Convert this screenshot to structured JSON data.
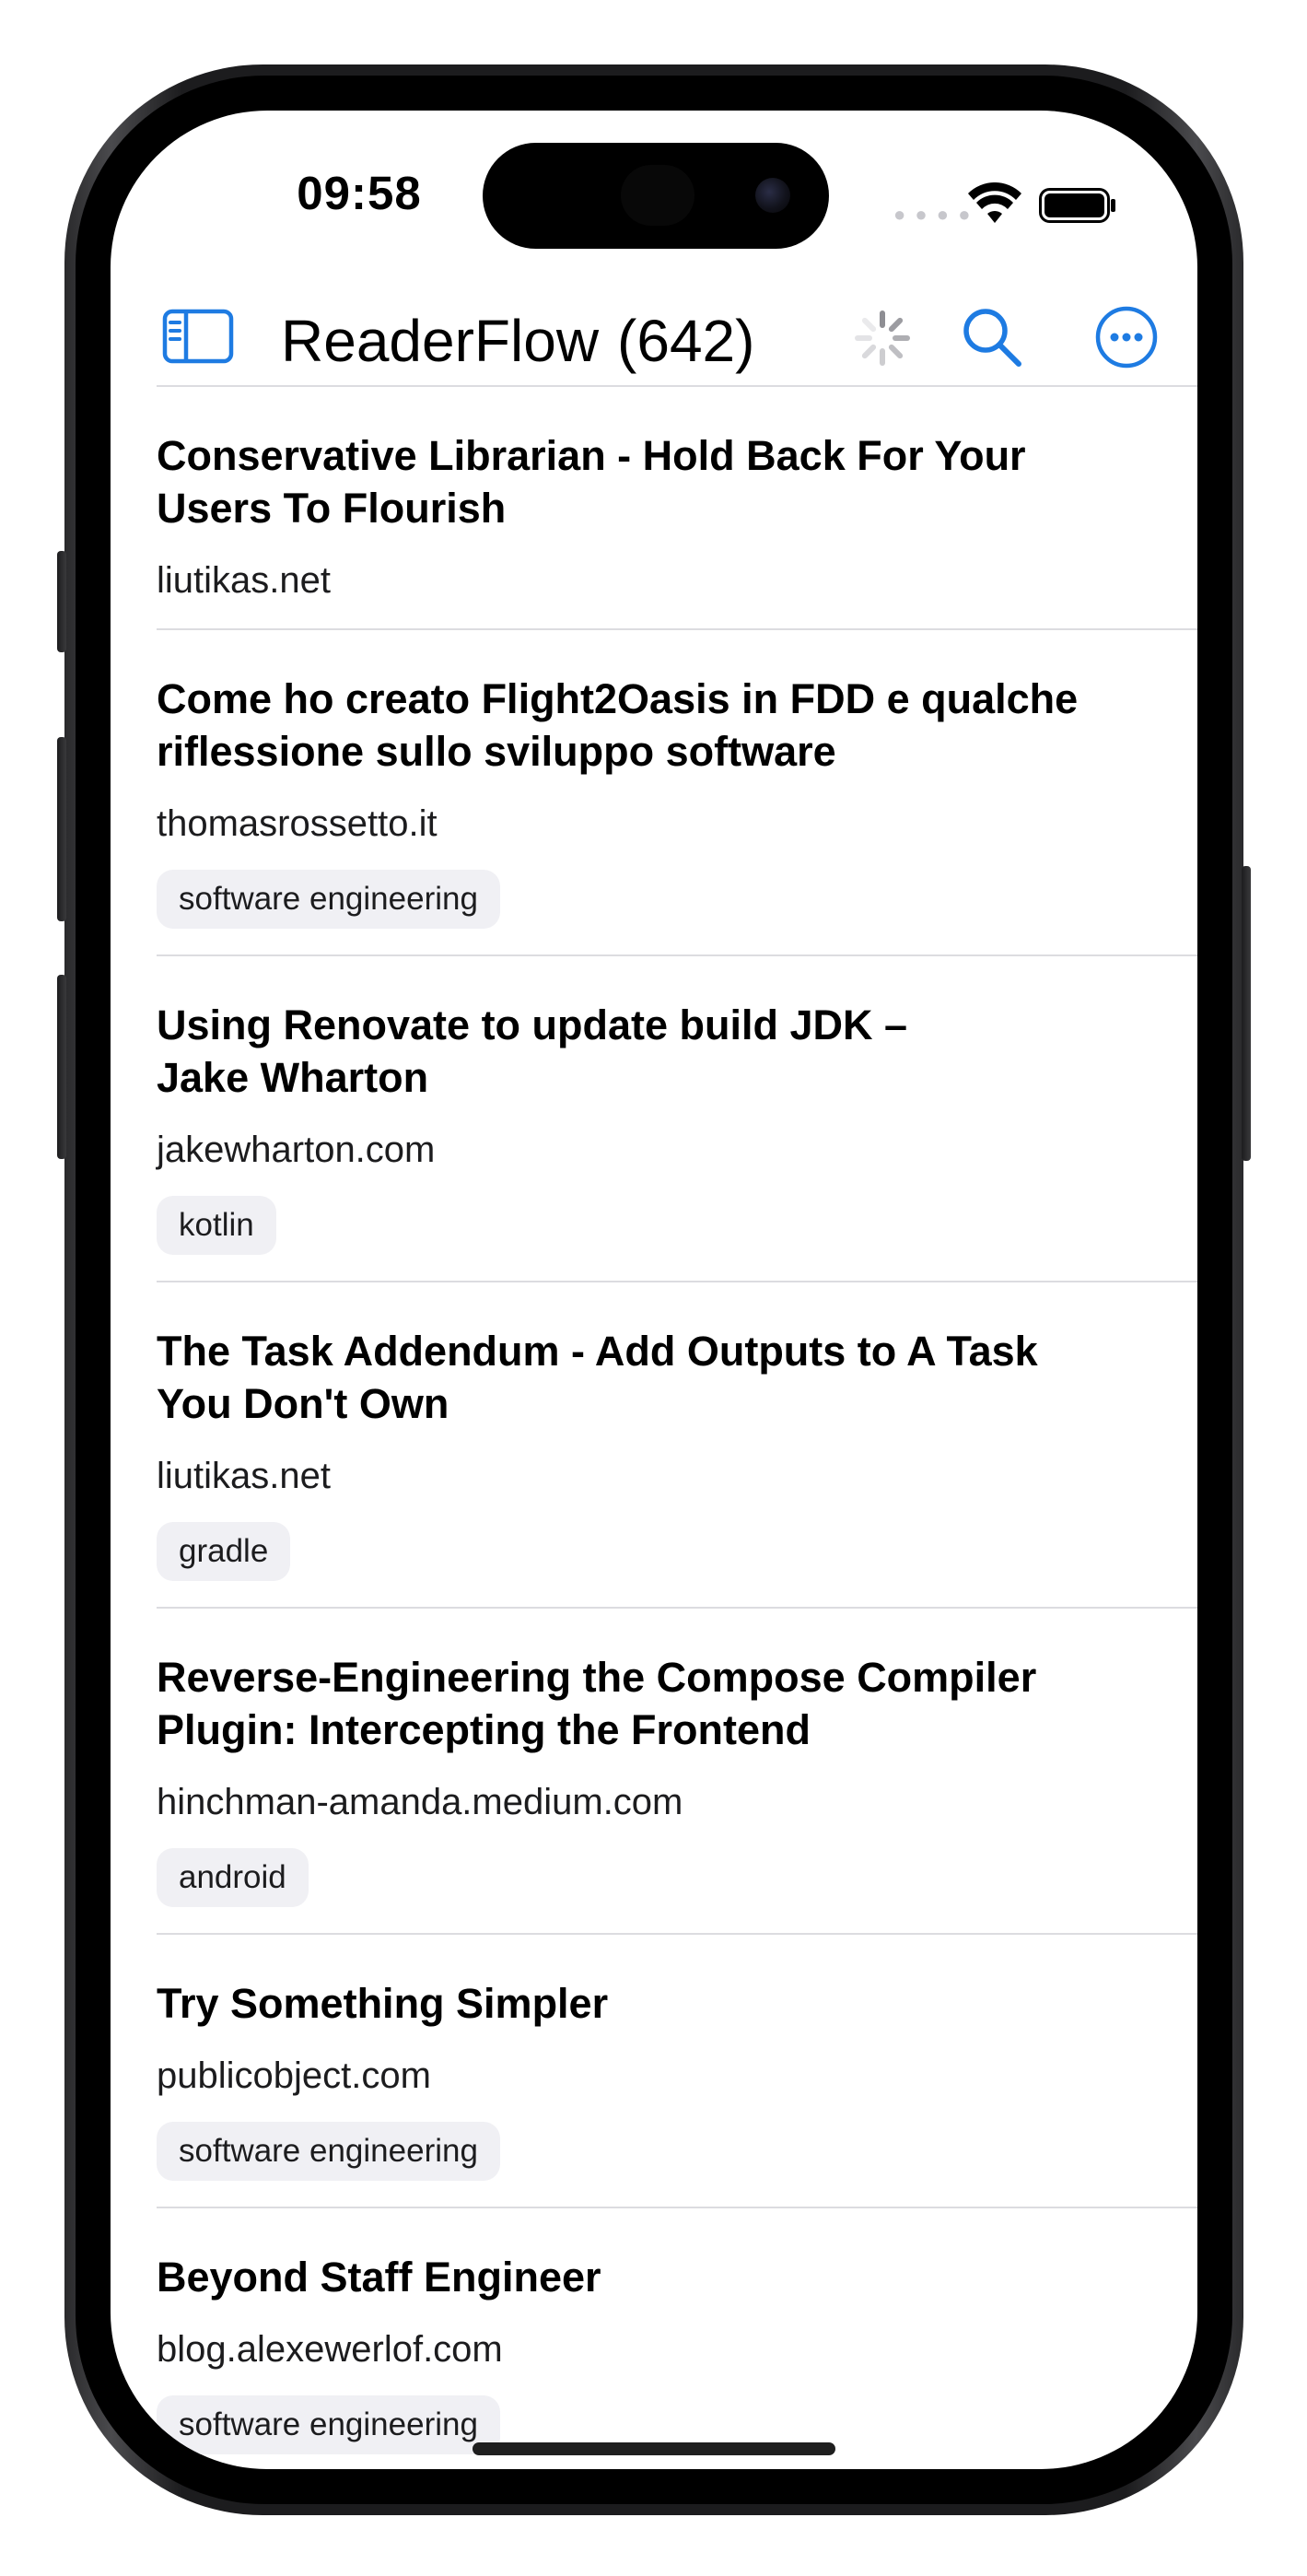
{
  "status_bar": {
    "time": "09:58"
  },
  "nav": {
    "app_name": "ReaderFlow",
    "count": "(642)",
    "accent_color": "#1E7BE2"
  },
  "articles": [
    {
      "title": "Conservative Librarian - Hold Back For Your\nUsers To Flourish",
      "domain": "liutikas.net",
      "tag": ""
    },
    {
      "title": "Come ho creato Flight2Oasis in FDD e qualche\nriflessione sullo sviluppo software",
      "domain": "thomasrossetto.it",
      "tag": "software engineering"
    },
    {
      "title": "Using Renovate to update build JDK –\nJake Wharton",
      "domain": "jakewharton.com",
      "tag": "kotlin"
    },
    {
      "title": "The Task Addendum - Add Outputs to A Task\nYou Don't Own",
      "domain": "liutikas.net",
      "tag": "gradle"
    },
    {
      "title": "Reverse-Engineering the Compose Compiler\nPlugin: Intercepting the Frontend",
      "domain": "hinchman-amanda.medium.com",
      "tag": "android"
    },
    {
      "title": "Try Something Simpler",
      "domain": "publicobject.com",
      "tag": "software engineering"
    },
    {
      "title": "Beyond Staff Engineer",
      "domain": "blog.alexewerlof.com",
      "tag": "software engineering"
    }
  ]
}
